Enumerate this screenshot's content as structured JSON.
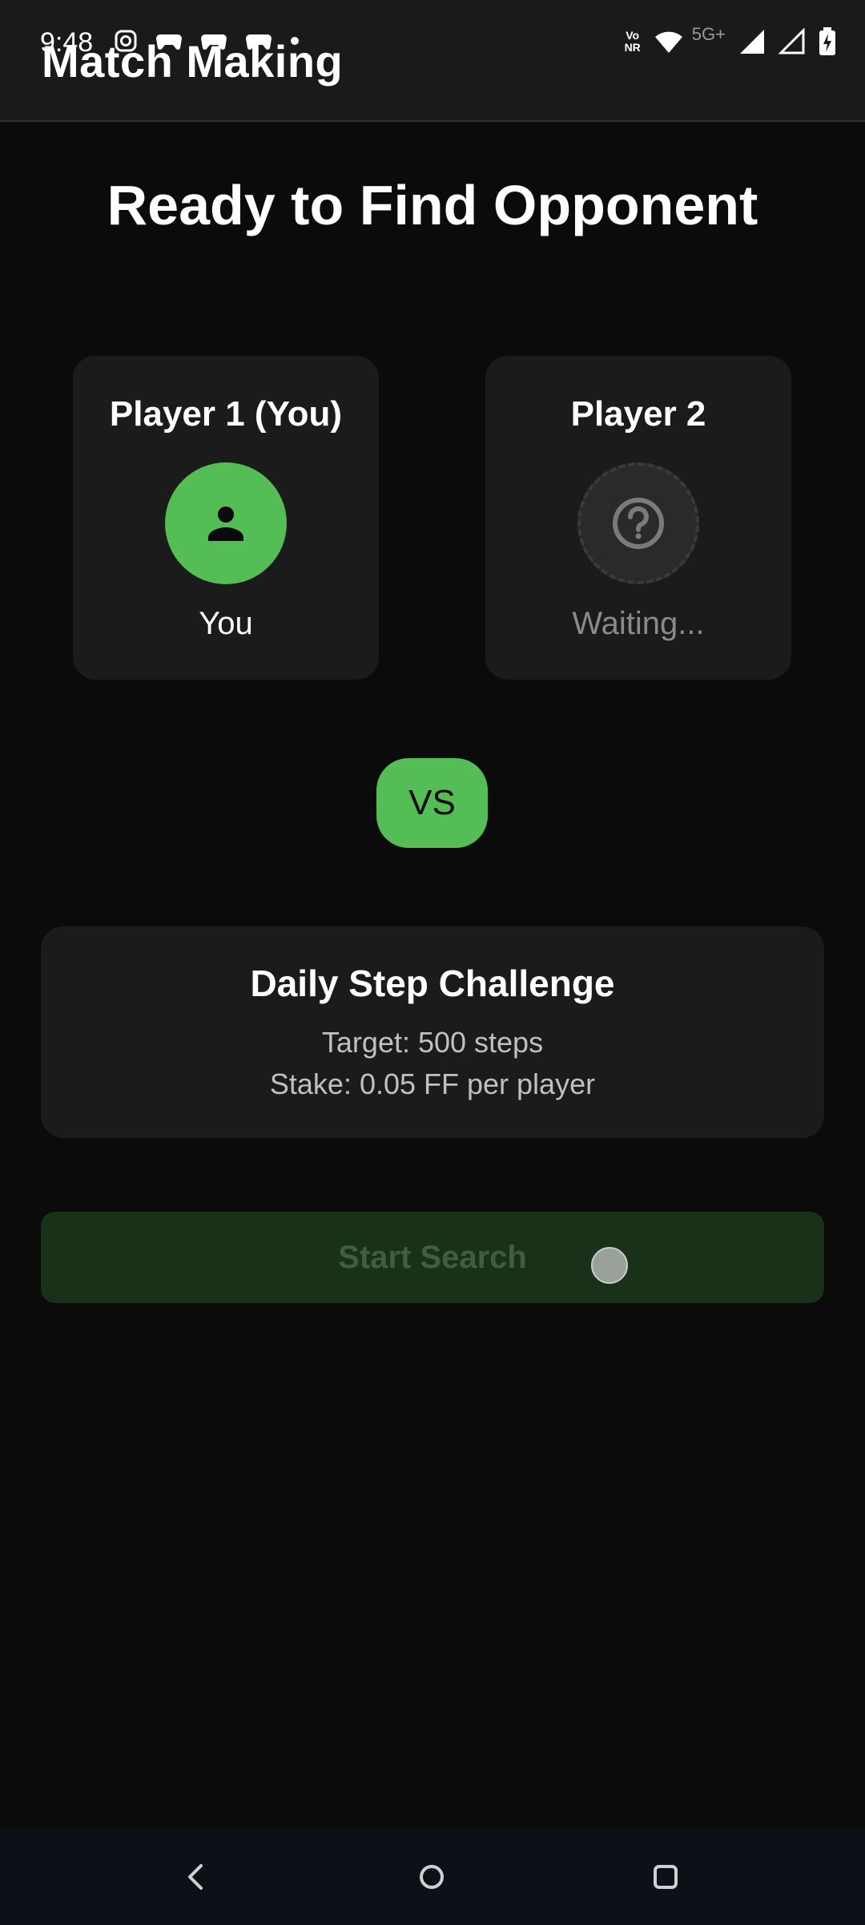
{
  "status_bar": {
    "time": "9:48",
    "left_icons": [
      "instagram-icon",
      "game-controller-icon",
      "game-controller-icon",
      "game-controller-icon",
      "notification-dot-icon"
    ],
    "volte_top": "Vo",
    "volte_bottom": "NR",
    "network": "5G+",
    "right_icons": [
      "vonr-icon",
      "wifi-icon",
      "signal-icon",
      "signal-outline-icon",
      "battery-charging-icon"
    ]
  },
  "app_bar": {
    "title": "Match Making"
  },
  "main": {
    "heading": "Ready to Find Opponent",
    "player1": {
      "label": "Player 1 (You)",
      "status": "You",
      "avatar_icon": "person-icon"
    },
    "player2": {
      "label": "Player 2",
      "status": "Waiting...",
      "avatar_icon": "question-icon"
    },
    "vs_label": "VS",
    "challenge": {
      "title": "Daily Step Challenge",
      "target": "Target: 500 steps",
      "stake": "Stake: 0.05 FF per player"
    },
    "start_button": {
      "label": "Start Search",
      "enabled": false
    }
  },
  "nav_bar": {
    "icons": [
      "back-icon",
      "home-icon",
      "recents-icon"
    ]
  },
  "colors": {
    "accent": "#55bd55",
    "background": "#0b0b0b",
    "card": "#1b1b1b",
    "button_disabled_bg": "#193019",
    "button_disabled_text": "#3f5d3f"
  }
}
